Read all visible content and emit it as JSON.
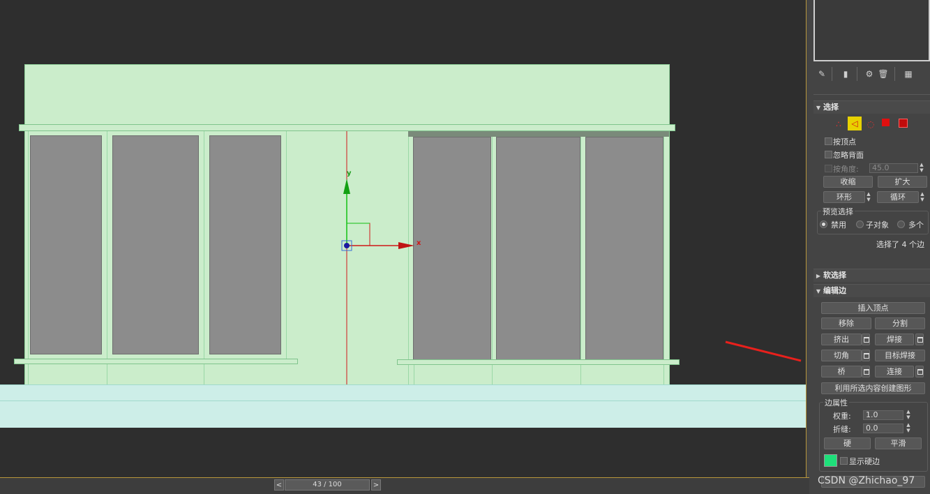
{
  "timeline": {
    "prev_label": "<",
    "next_label": ">",
    "frame_text": "43 / 100"
  },
  "gizmo": {
    "x_label": "x",
    "y_label": "y"
  },
  "toolbar_icons": [
    "pin-icon",
    "hierarchy-icon",
    "instance-icon",
    "trash-icon",
    "configure-icon"
  ],
  "selection_rollout": {
    "title": "选择",
    "subobject_icons": [
      "vertex-icon",
      "edge-icon",
      "border-icon",
      "polygon-icon",
      "element-icon"
    ],
    "by_vertex": "按顶点",
    "ignore_backfacing": "忽略背面",
    "by_angle": "按角度:",
    "angle_value": "45.0",
    "shrink": "收缩",
    "grow": "扩大",
    "ring": "环形",
    "loop": "循环",
    "preview_title": "预览选择",
    "preview_options": [
      "禁用",
      "子对象",
      "多个"
    ],
    "status": "选择了 4 个边"
  },
  "soft_selection_rollout": {
    "title": "软选择"
  },
  "edit_edges_rollout": {
    "title": "编辑边",
    "insert_vertex": "插入顶点",
    "remove": "移除",
    "split": "分割",
    "extrude": "挤出",
    "weld": "焊接",
    "chamfer": "切角",
    "target_weld": "目标焊接",
    "bridge": "桥",
    "connect": "连接",
    "create_shape": "利用所选内容创建图形",
    "edge_props_title": "边属性",
    "weight_label": "权重:",
    "weight_value": "1.0",
    "crease_label": "折缝:",
    "crease_value": "0.0",
    "hard": "硬",
    "smooth": "平滑",
    "show_hard_edges": "显示硬边",
    "hard_edge_color": "#1ee07a"
  },
  "watermark": "CSDN @Zhichao_97",
  "colors": {
    "accent_yellow": "#e8d200",
    "arrow_red": "#e8201c"
  }
}
